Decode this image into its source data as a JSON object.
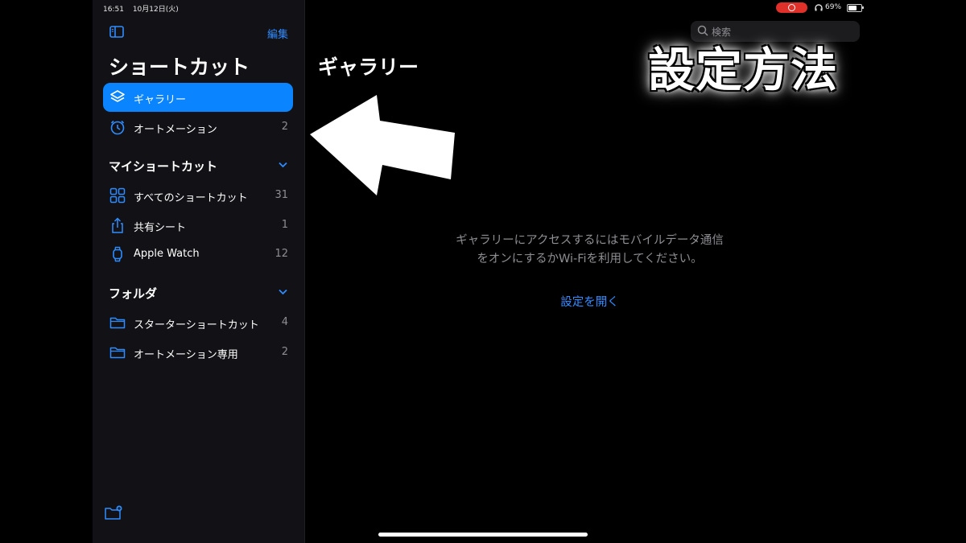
{
  "status_bar": {
    "time": "16:51",
    "date": "10月12日(火)",
    "battery_text": "69%",
    "battery_level": 0.69
  },
  "sidebar": {
    "edit_label": "編集",
    "title": "ショートカット",
    "items": [
      {
        "label": "ギャラリー",
        "count": "",
        "icon": "gallery-layers-icon",
        "selected": true
      },
      {
        "label": "オートメーション",
        "count": "2",
        "icon": "automation-clock-icon"
      }
    ],
    "my_shortcuts": {
      "heading": "マイショートカット",
      "items": [
        {
          "label": "すべてのショートカット",
          "count": "31",
          "icon": "grid-icon"
        },
        {
          "label": "共有シート",
          "count": "1",
          "icon": "share-icon"
        },
        {
          "label": "Apple Watch",
          "count": "12",
          "icon": "watch-icon"
        }
      ]
    },
    "folders": {
      "heading": "フォルダ",
      "items": [
        {
          "label": "スターターショートカット",
          "count": "4",
          "icon": "folder-icon"
        },
        {
          "label": "オートメーション専用",
          "count": "2",
          "icon": "folder-icon"
        }
      ]
    }
  },
  "main": {
    "title": "ギャラリー",
    "search_placeholder": "検索",
    "message_line1": "ギャラリーにアクセスするにはモバイルデータ通信",
    "message_line2": "をオンにするかWi-Fiを利用してください。",
    "open_settings": "設定を開く"
  },
  "overlay": {
    "caption": "設定方法"
  },
  "colors": {
    "accent": "#0a84ff",
    "link": "#2f8cff",
    "sidebar_bg": "#121216",
    "recording": "#e0302a"
  }
}
